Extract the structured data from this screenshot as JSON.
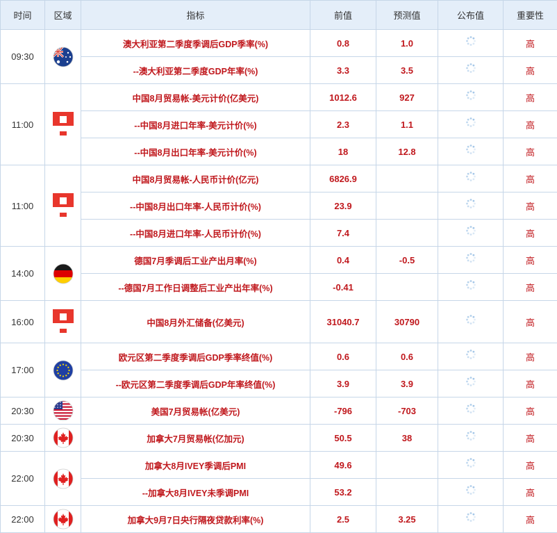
{
  "header": {
    "time": "时间",
    "region": "区域",
    "indicator": "指标",
    "previous": "前值",
    "forecast": "预测值",
    "actual": "公布值",
    "importance": "重要性"
  },
  "groups": [
    {
      "time": "09:30",
      "flag_icon": "australia-flag-icon",
      "rows": [
        {
          "indicator": "澳大利亚第二季度季调后GDP季率(%)",
          "previous": "0.8",
          "forecast": "1.0",
          "importance": "高"
        },
        {
          "indicator": "--澳大利亚第二季度GDP年率(%)",
          "previous": "3.3",
          "forecast": "3.5",
          "importance": "高"
        }
      ]
    },
    {
      "time": "11:00",
      "flag_icon": "china-flag-icon",
      "rows": [
        {
          "indicator": "中国8月贸易帐-美元计价(亿美元)",
          "previous": "1012.6",
          "forecast": "927",
          "importance": "高"
        },
        {
          "indicator": "--中国8月进口年率-美元计价(%)",
          "previous": "2.3",
          "forecast": "1.1",
          "importance": "高"
        },
        {
          "indicator": "--中国8月出口年率-美元计价(%)",
          "previous": "18",
          "forecast": "12.8",
          "importance": "高"
        }
      ]
    },
    {
      "time": "11:00",
      "flag_icon": "china-flag-icon",
      "rows": [
        {
          "indicator": "中国8月贸易帐-人民币计价(亿元)",
          "previous": "6826.9",
          "forecast": "",
          "importance": "高"
        },
        {
          "indicator": "--中国8月出口年率-人民币计价(%)",
          "previous": "23.9",
          "forecast": "",
          "importance": "高"
        },
        {
          "indicator": "--中国8月进口年率-人民币计价(%)",
          "previous": "7.4",
          "forecast": "",
          "importance": "高"
        }
      ]
    },
    {
      "time": "14:00",
      "flag_icon": "germany-flag-icon",
      "rows": [
        {
          "indicator": "德国7月季调后工业产出月率(%)",
          "previous": "0.4",
          "forecast": "-0.5",
          "importance": "高"
        },
        {
          "indicator": "--德国7月工作日调整后工业产出年率(%)",
          "previous": "-0.41",
          "forecast": "",
          "importance": "高"
        }
      ]
    },
    {
      "time": "16:00",
      "flag_icon": "china-flag-icon",
      "rows": [
        {
          "indicator": "中国8月外汇储备(亿美元)",
          "previous": "31040.7",
          "forecast": "30790",
          "importance": "高"
        }
      ]
    },
    {
      "time": "17:00",
      "flag_icon": "eu-flag-icon",
      "rows": [
        {
          "indicator": "欧元区第二季度季调后GDP季率终值(%)",
          "previous": "0.6",
          "forecast": "0.6",
          "importance": "高"
        },
        {
          "indicator": "--欧元区第二季度季调后GDP年率终值(%)",
          "previous": "3.9",
          "forecast": "3.9",
          "importance": "高"
        }
      ]
    },
    {
      "time": "20:30",
      "flag_icon": "usa-flag-icon",
      "rows": [
        {
          "indicator": "美国7月贸易帐(亿美元)",
          "previous": "-796",
          "forecast": "-703",
          "importance": "高"
        }
      ]
    },
    {
      "time": "20:30",
      "flag_icon": "canada-flag-icon",
      "rows": [
        {
          "indicator": "加拿大7月贸易帐(亿加元)",
          "previous": "50.5",
          "forecast": "38",
          "importance": "高"
        }
      ]
    },
    {
      "time": "22:00",
      "flag_icon": "canada-flag-icon",
      "rows": [
        {
          "indicator": "加拿大8月IVEY季调后PMI",
          "previous": "49.6",
          "forecast": "",
          "importance": "高"
        },
        {
          "indicator": "--加拿大8月IVEY未季调PMI",
          "previous": "53.2",
          "forecast": "",
          "importance": "高"
        }
      ]
    },
    {
      "time": "22:00",
      "flag_icon": "canada-flag-icon",
      "rows": [
        {
          "indicator": "加拿大9月7日央行隔夜贷款利率(%)",
          "previous": "2.5",
          "forecast": "3.25",
          "importance": "高"
        }
      ]
    }
  ],
  "colors": {
    "header_bg": "#e4eef9",
    "border": "#c6d6e8",
    "accent_red": "#c0181d",
    "spinner": "#9ec3e6"
  }
}
